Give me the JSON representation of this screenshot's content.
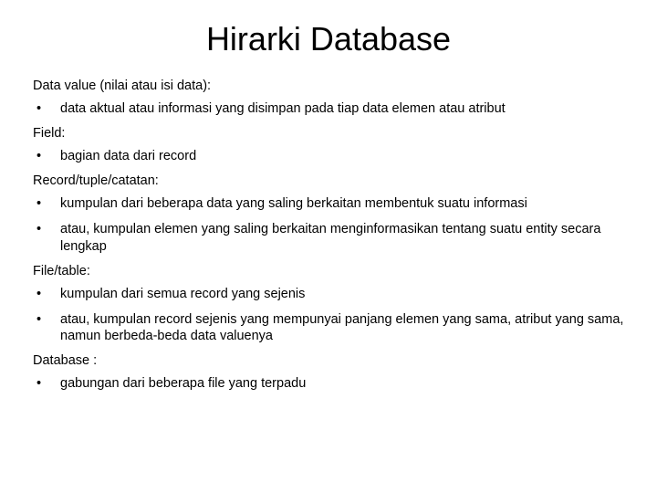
{
  "title": "Hirarki Database",
  "sections": [
    {
      "heading": "Data value (nilai atau isi data):",
      "items": [
        "data aktual atau informasi yang disimpan pada tiap data elemen atau atribut"
      ]
    },
    {
      "heading": "Field:",
      "items": [
        "bagian data dari record"
      ]
    },
    {
      "heading": "Record/tuple/catatan:",
      "items": [
        "kumpulan dari beberapa data yang saling berkaitan membentuk suatu informasi",
        "atau, kumpulan elemen yang saling berkaitan menginformasikan tentang suatu entity secara lengkap"
      ]
    },
    {
      "heading": "File/table:",
      "items": [
        "kumpulan dari semua record yang sejenis",
        "atau, kumpulan record sejenis yang mempunyai panjang elemen yang sama, atribut yang sama, namun berbeda-beda data valuenya"
      ]
    },
    {
      "heading": "Database :",
      "items": [
        "gabungan dari beberapa file yang terpadu"
      ]
    }
  ]
}
